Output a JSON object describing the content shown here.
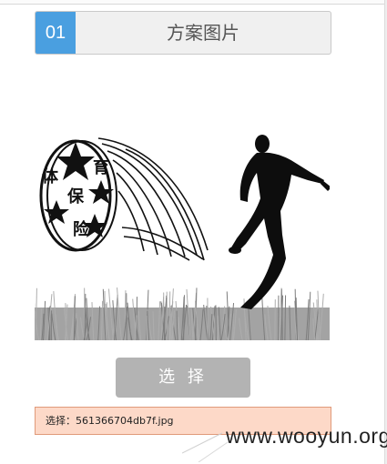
{
  "step": {
    "number": "01",
    "title": "方案图片"
  },
  "preview": {
    "badge_chars": [
      "体",
      "育",
      "保",
      "险"
    ]
  },
  "actions": {
    "choose_label": "选 择"
  },
  "file": {
    "prefix": "选择：",
    "name": "561366704db7f.jpg"
  },
  "watermark": "www.wooyun.org",
  "colors": {
    "step_accent": "#4a9fe0",
    "button": "#b3b3b3",
    "file_bar_bg": "#fdd9c8",
    "file_bar_border": "#e09a7a"
  }
}
